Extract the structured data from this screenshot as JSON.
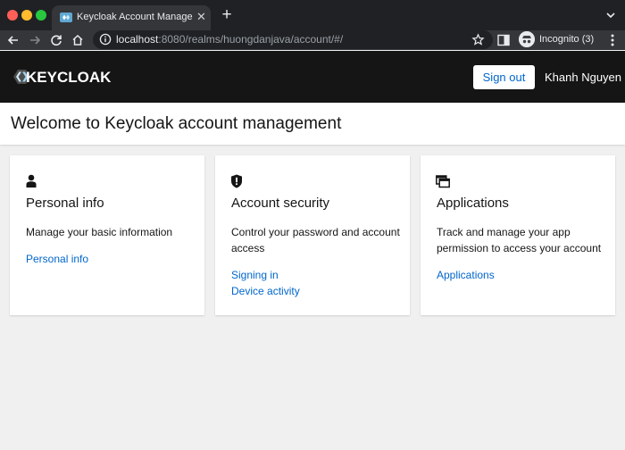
{
  "browser": {
    "tab_title": "Keycloak Account Management",
    "tab_close": "✕",
    "new_tab": "+",
    "url_host": "localhost",
    "url_rest": ":8080/realms/huongdanjava/account/#/",
    "incognito_label": "Incognito (3)"
  },
  "header": {
    "logo_text": "KEYCLOAK",
    "sign_out_label": "Sign out",
    "username": "Khanh Nguyen"
  },
  "page": {
    "title": "Welcome to Keycloak account management"
  },
  "cards": [
    {
      "icon": "user-icon",
      "title": "Personal info",
      "description": "Manage your basic information",
      "links": [
        "Personal info"
      ]
    },
    {
      "icon": "shield-icon",
      "title": "Account security",
      "description": "Control your password and account access",
      "links": [
        "Signing in",
        "Device activity"
      ]
    },
    {
      "icon": "applications-icon",
      "title": "Applications",
      "description": "Track and manage your app permission to access your account",
      "links": [
        "Applications"
      ]
    }
  ],
  "colors": {
    "header_bg": "#151515",
    "link": "#0066cc",
    "page_bg": "#f0f0f0"
  }
}
